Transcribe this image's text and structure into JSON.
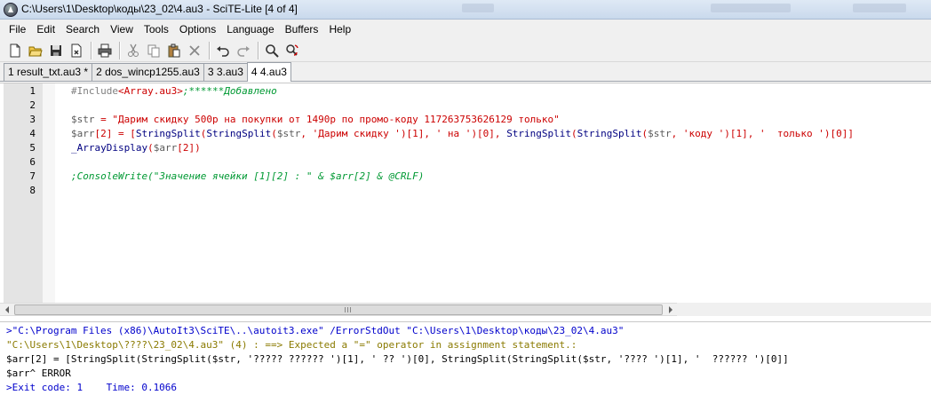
{
  "window": {
    "title": "C:\\Users\\1\\Desktop\\коды\\23_02\\4.au3 - SciTE-Lite [4 of 4]"
  },
  "menu": [
    "File",
    "Edit",
    "Search",
    "View",
    "Tools",
    "Options",
    "Language",
    "Buffers",
    "Help"
  ],
  "toolbar": {
    "icons": [
      "new-file-icon",
      "open-folder-icon",
      "save-icon",
      "close-file-icon",
      "print-icon",
      "cut-icon",
      "copy-icon",
      "paste-icon",
      "delete-icon",
      "undo-icon",
      "redo-icon",
      "find-icon",
      "replace-icon"
    ]
  },
  "tabs": [
    {
      "label": "1 result_txt.au3 *",
      "active": false
    },
    {
      "label": "2 dos_wincp1255.au3",
      "active": false
    },
    {
      "label": "3 3.au3",
      "active": false
    },
    {
      "label": "4 4.au3",
      "active": true
    }
  ],
  "editor": {
    "line_numbers": [
      "1",
      "2",
      "3",
      "4",
      "5",
      "6",
      "7",
      "8"
    ],
    "line1": {
      "dir": "#Include",
      "lib": "<Array.au3>",
      "cmt": ";******Добавлено"
    },
    "line3": {
      "var": "$str",
      "op": " = ",
      "str": "\"Дарим скидку 500р на покупки от 1490р по промо-коду 117263753626129 только\""
    },
    "line4": {
      "a": "$arr",
      "b": "[2]",
      "c": " = ",
      "d": "[",
      "e": "StringSplit",
      "f": "(",
      "g": "StringSplit",
      "h": "(",
      "i": "$str",
      "j": ", ",
      "k": "'Дарим скидку '",
      "l": ")[1], ",
      "m": "' на '",
      "n": ")[0], ",
      "o": "StringSplit",
      "p": "(",
      "q": "StringSplit",
      "r": "(",
      "s": "$str",
      "t": ", ",
      "u": "'коду '",
      "v": ")[1], ",
      "w": "'  только '",
      "x": ")[0]]"
    },
    "line5": {
      "fn": "_ArrayDisplay",
      "p1": "(",
      "var": "$arr",
      "idx": "[2]",
      "p2": ")"
    },
    "line7": {
      "cmt": ";ConsoleWrite(\"Значение ячейки [1][2] : \" & $arr[2] & @CRLF)"
    }
  },
  "output": {
    "lines": [
      ">\"C:\\Program Files (x86)\\AutoIt3\\SciTE\\..\\autoit3.exe\" /ErrorStdOut \"C:\\Users\\1\\Desktop\\коды\\23_02\\4.au3\"",
      "\"C:\\Users\\1\\Desktop\\????\\23_02\\4.au3\" (4) : ==> Expected a \"=\" operator in assignment statement.:",
      "$arr[2] = [StringSplit(StringSplit($str, '????? ?????? ')[1], ' ?? ')[0], StringSplit(StringSplit($str, '???? ')[1], '  ?????? ')[0]]",
      "$arr^ ERROR",
      ">Exit code: 1    Time: 0.1066"
    ]
  },
  "colors": {
    "keyword_red": "#cc0000",
    "comment_green": "#009933",
    "function_navy": "#000080",
    "output_blue": "#0000cc",
    "output_gold": "#8a7a00"
  }
}
